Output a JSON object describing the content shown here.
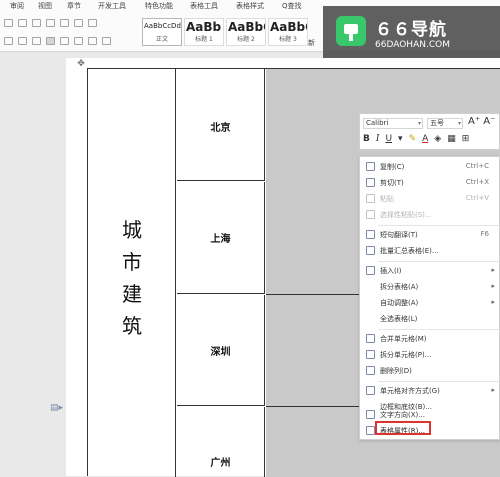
{
  "ribbon": {
    "tabs": [
      "审阅",
      "视图",
      "章节",
      "开发工具",
      "特色功能",
      "表格工具",
      "表格样式"
    ],
    "search_label": "Q查找",
    "styles": [
      {
        "sample": "AaBbCcDd",
        "name": "正文"
      },
      {
        "sample": "AaBb",
        "name": "标题 1"
      },
      {
        "sample": "AaBbC",
        "name": "标题 2"
      },
      {
        "sample": "AaBbC",
        "name": "标题 3"
      }
    ],
    "new_style": "新"
  },
  "watermark": {
    "title": "６６导航",
    "subtitle": "66DAOHAN.COM",
    "brand_color": "#38c76a"
  },
  "table": {
    "merged_label": "城市建筑",
    "cities": [
      "北京",
      "上海",
      "深圳",
      "广州"
    ],
    "shade_color": "#c9c9c9"
  },
  "mini_toolbar": {
    "font": "Calibri",
    "size": "五号",
    "grow_shrink": "A⁺ A⁻",
    "format_buttons": [
      "B",
      "I",
      "U",
      "A"
    ]
  },
  "context_menu": {
    "items": [
      {
        "icon": "copy-icon",
        "label": "复制(C)",
        "shortcut": "Ctrl+C",
        "disabled": false
      },
      {
        "icon": "cut-icon",
        "label": "剪切(T)",
        "shortcut": "Ctrl+X",
        "disabled": false
      },
      {
        "icon": "paste-icon",
        "label": "粘贴",
        "shortcut": "Ctrl+V",
        "disabled": true
      },
      {
        "icon": "paste-special-icon",
        "label": "选择性粘贴(S)...",
        "shortcut": "",
        "disabled": true
      },
      {
        "icon": "translate-icon",
        "label": "短句翻译(T)",
        "shortcut": "F6",
        "disabled": false
      },
      {
        "icon": "summary-icon",
        "label": "批量汇总表格(E)...",
        "shortcut": "",
        "disabled": false
      },
      {
        "icon": "insert-icon",
        "label": "插入(I)",
        "shortcut": "",
        "disabled": false,
        "submenu": true
      },
      {
        "icon": "",
        "label": "拆分表格(A)",
        "shortcut": "",
        "disabled": false,
        "submenu": true
      },
      {
        "icon": "",
        "label": "自动调整(A)",
        "shortcut": "",
        "disabled": false,
        "submenu": true
      },
      {
        "icon": "",
        "label": "全选表格(L)",
        "shortcut": "",
        "disabled": false
      },
      {
        "icon": "merge-icon",
        "label": "合并单元格(M)",
        "shortcut": "",
        "disabled": false
      },
      {
        "icon": "split-cells-icon",
        "label": "拆分单元格(P)...",
        "shortcut": "",
        "disabled": false
      },
      {
        "icon": "delete-column-icon",
        "label": "删除列(D)",
        "shortcut": "",
        "disabled": false
      },
      {
        "icon": "align-icon",
        "label": "单元格对齐方式(G)",
        "shortcut": "",
        "disabled": false,
        "submenu": true
      },
      {
        "icon": "",
        "label": "边框和底纹(B)...",
        "shortcut": "",
        "disabled": false
      },
      {
        "icon": "text-direction-icon",
        "label": "文字方向(X)...",
        "shortcut": "",
        "disabled": false
      },
      {
        "icon": "table-properties-icon",
        "label": "表格属性(R)...",
        "shortcut": "",
        "disabled": false,
        "highlighted": true
      }
    ]
  }
}
